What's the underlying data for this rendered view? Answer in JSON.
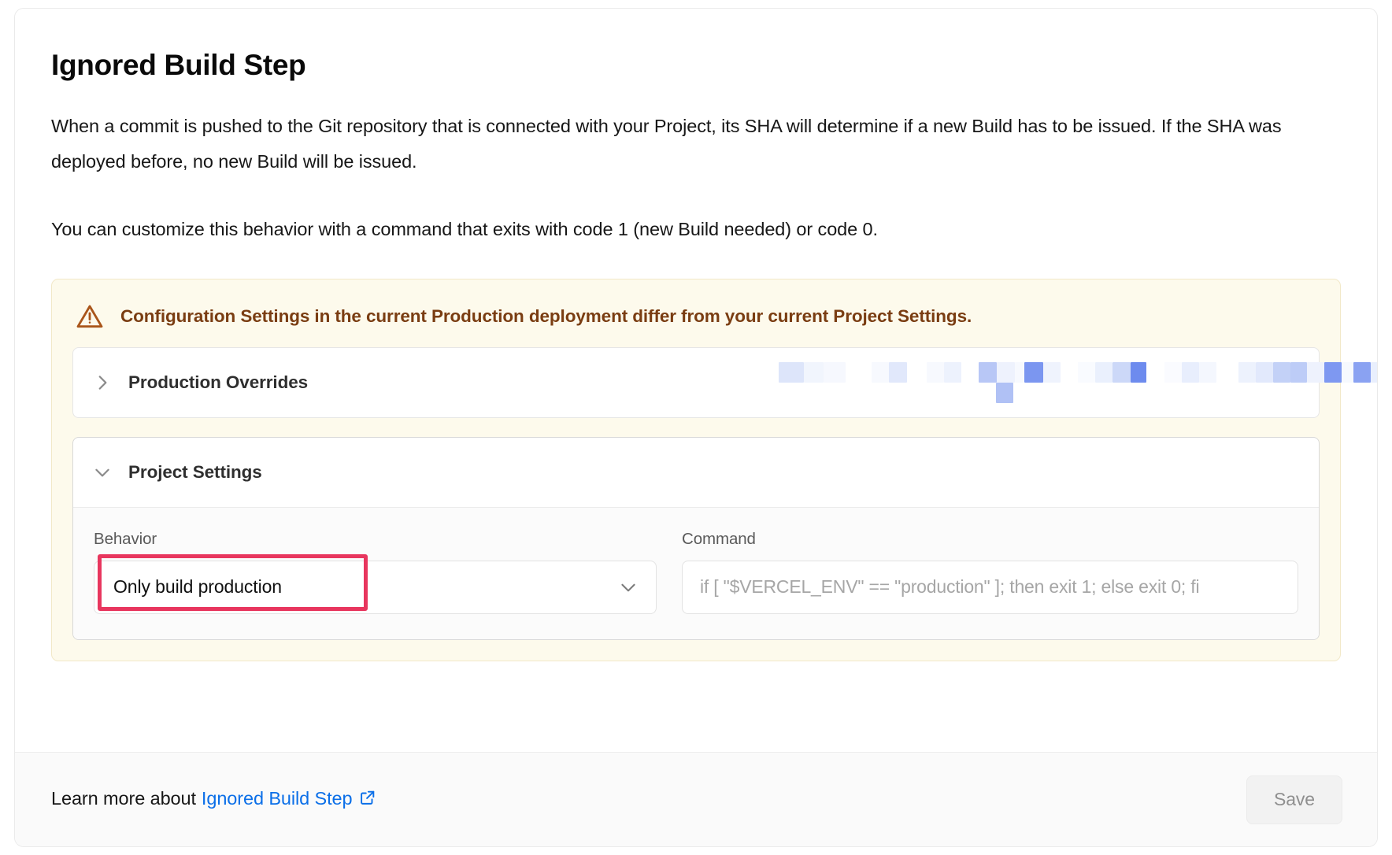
{
  "card": {
    "title": "Ignored Build Step",
    "paragraphs": [
      "When a commit is pushed to the Git repository that is connected with your Project, its SHA will determine if a new Build has to be issued. If the SHA was deployed before, no new Build will be issued.",
      "You can customize this behavior with a command that exits with code 1 (new Build needed) or code 0."
    ]
  },
  "diff_banner": {
    "icon": "warning-triangle-icon",
    "message": "Configuration Settings in the current Production deployment differ from your current Project Settings.",
    "text_color": "#7a3d12",
    "background": "#fdfaec"
  },
  "production_overrides": {
    "label": "Production Overrides",
    "expanded": false,
    "chevron": "chevron-right-icon",
    "redacted": true
  },
  "project_settings": {
    "label": "Project Settings",
    "expanded": true,
    "chevron": "chevron-down-icon",
    "behavior": {
      "label": "Behavior",
      "value": "Only build production",
      "chevron": "chevron-down-icon",
      "highlight_color": "#e8365e",
      "highlighted": true
    },
    "command": {
      "label": "Command",
      "value": "",
      "placeholder": "if [ \"$VERCEL_ENV\" == \"production\" ]; then exit 1; else exit 0; fi"
    }
  },
  "footer": {
    "learn_more_prefix": "Learn more about",
    "learn_more_link": "Ignored Build Step",
    "link_icon": "external-link-icon",
    "link_color": "#0b6fe8",
    "save_label": "Save"
  }
}
